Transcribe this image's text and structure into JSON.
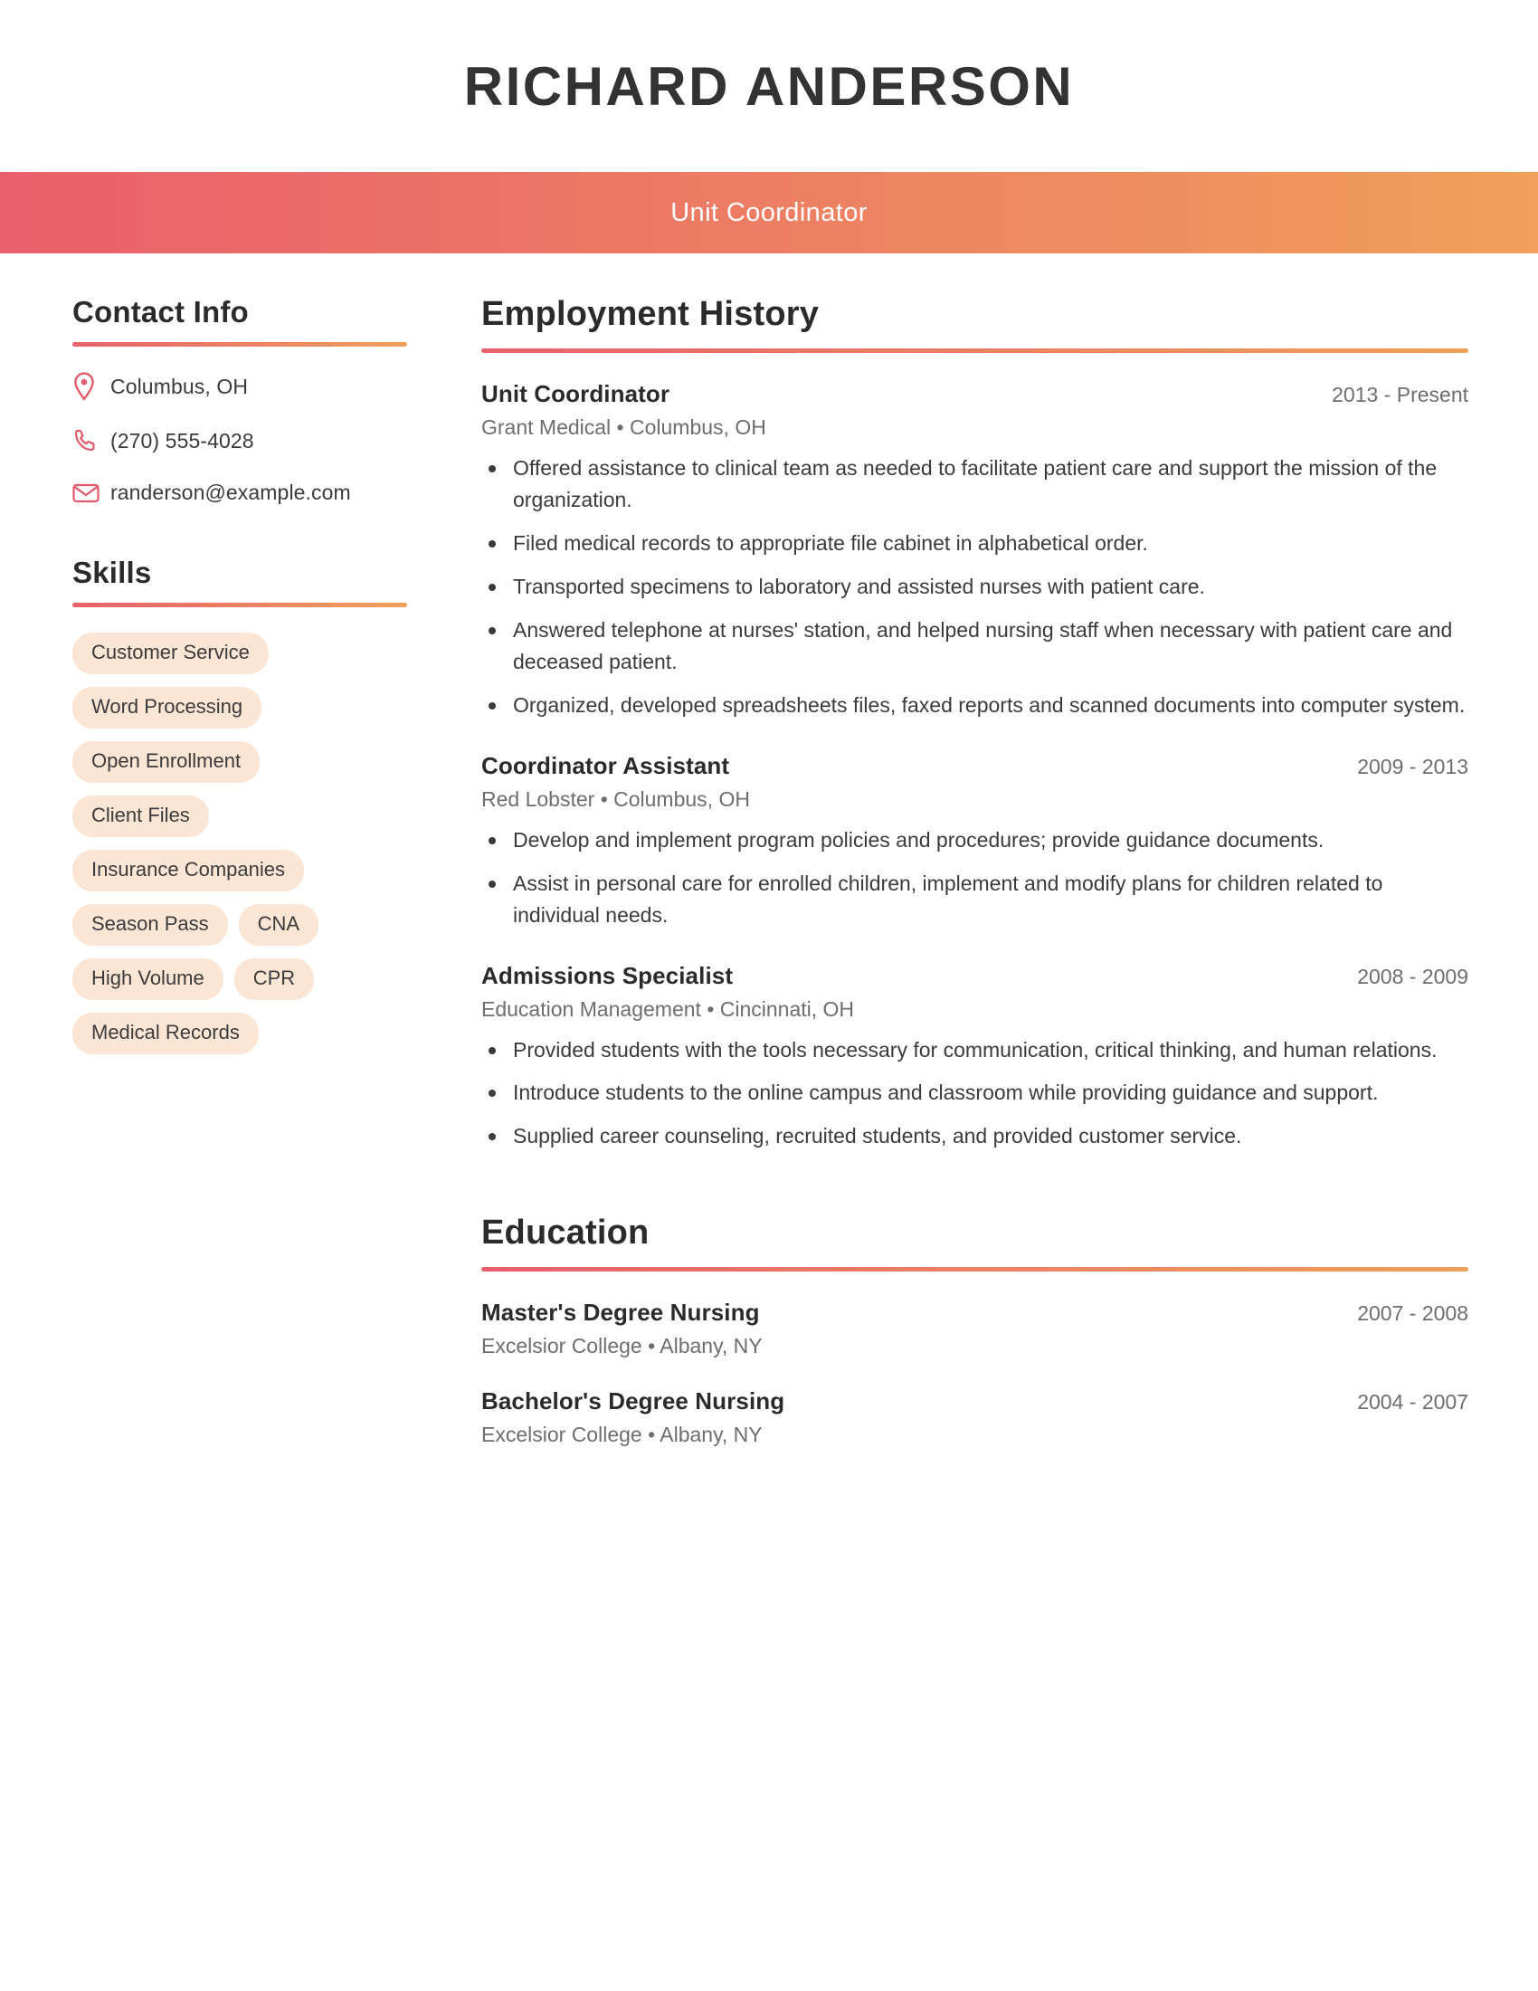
{
  "header": {
    "full_name": "RICHARD ANDERSON",
    "job_title": "Unit Coordinator",
    "accent_start": "#e8606b",
    "accent_end": "#f0a05a"
  },
  "sidebar": {
    "contact_heading": "Contact Info",
    "contact_items": [
      {
        "icon": "location-pin-icon",
        "value": "Columbus, OH"
      },
      {
        "icon": "phone-icon",
        "value": "(270) 555-4028"
      },
      {
        "icon": "envelope-icon",
        "value": "randerson@example.com"
      }
    ],
    "skills_heading": "Skills",
    "skills": [
      "Customer Service",
      "Word Processing",
      "Open Enrollment",
      "Client Files",
      "Insurance Companies",
      "Season Pass",
      "CNA",
      "High Volume",
      "CPR",
      "Medical Records"
    ]
  },
  "employment": {
    "heading": "Employment History",
    "jobs": [
      {
        "title": "Unit Coordinator",
        "dates": "2013 - Present",
        "company_location": "Grant Medical  •  Columbus, OH",
        "bullets": [
          "Offered assistance to clinical team as needed to facilitate patient care and support the mission of the organization.",
          "Filed medical records to appropriate file cabinet in alphabetical order.",
          "Transported specimens to laboratory and assisted nurses with patient care.",
          "Answered telephone at nurses' station, and helped nursing staff when necessary with patient care and deceased patient.",
          "Organized, developed spreadsheets files, faxed reports and scanned documents into computer system."
        ]
      },
      {
        "title": "Coordinator Assistant",
        "dates": "2009 - 2013",
        "company_location": "Red Lobster  •  Columbus, OH",
        "bullets": [
          "Develop and implement program policies and procedures; provide guidance documents.",
          "Assist in personal care for enrolled children, implement and modify plans for children related to individual needs."
        ]
      },
      {
        "title": "Admissions Specialist",
        "dates": "2008 - 2009",
        "company_location": "Education Management  •  Cincinnati, OH",
        "bullets": [
          "Provided students with the tools necessary for communication, critical thinking, and human relations.",
          "Introduce students to the online campus and classroom while providing guidance and support.",
          "Supplied career counseling, recruited students, and provided customer service."
        ]
      }
    ]
  },
  "education": {
    "heading": "Education",
    "entries": [
      {
        "degree": "Master's Degree Nursing",
        "dates": "2007 - 2008",
        "school_location": "Excelsior College  •  Albany, NY"
      },
      {
        "degree": "Bachelor's Degree Nursing",
        "dates": "2004 - 2007",
        "school_location": "Excelsior College  •  Albany, NY"
      }
    ]
  }
}
